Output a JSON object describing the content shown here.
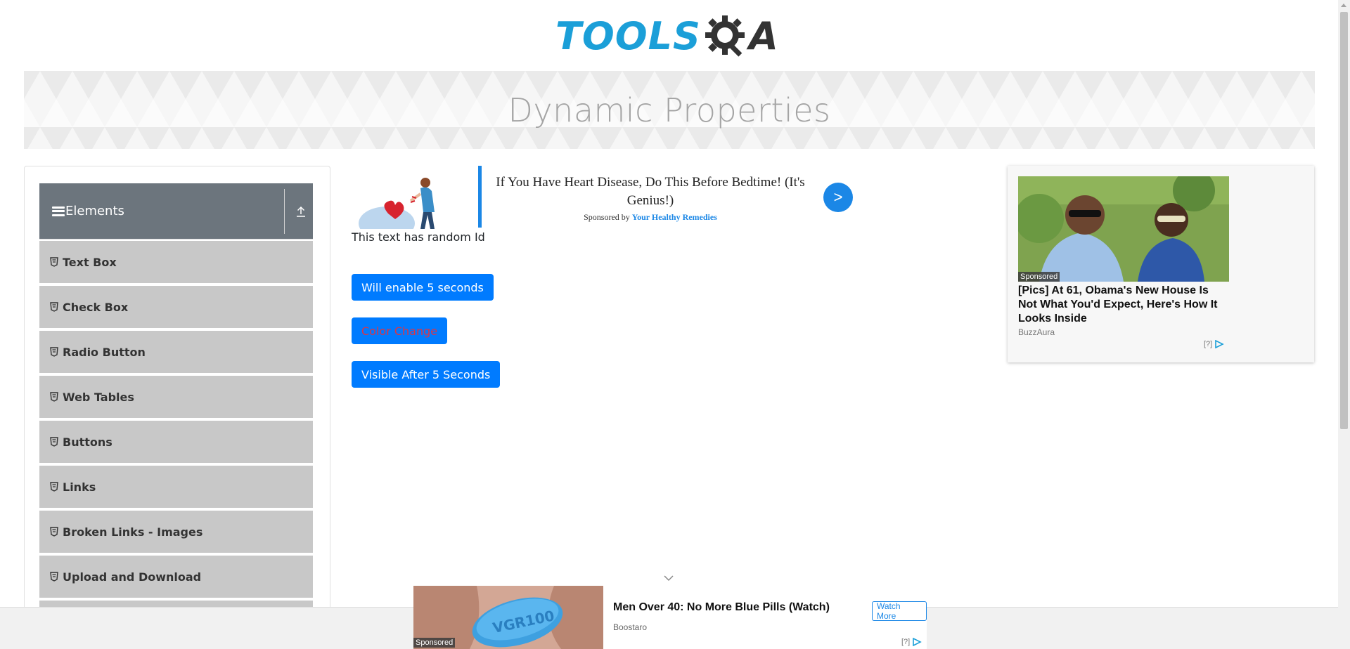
{
  "header": {
    "logo_left": "TOOLS",
    "logo_right": "A"
  },
  "banner": {
    "title": "Dynamic Properties"
  },
  "sidebar": {
    "group_title": "Elements",
    "items": [
      {
        "label": "Text Box"
      },
      {
        "label": "Check Box"
      },
      {
        "label": "Radio Button"
      },
      {
        "label": "Web Tables"
      },
      {
        "label": "Buttons"
      },
      {
        "label": "Links"
      },
      {
        "label": "Broken Links - Images"
      },
      {
        "label": "Upload and Download"
      }
    ]
  },
  "main_ad": {
    "headline": "If You Have Heart Disease, Do This Before Bedtime! (It's Genius!)",
    "sponsor_prefix": "Sponsored by",
    "sponsor_name": "Your Healthy Remedies",
    "arrow": ">"
  },
  "main": {
    "random_text": "This text has random Id",
    "enable_button": "Will enable 5 seconds",
    "color_button": "Color Change",
    "visible_button": "Visible After 5 Seconds"
  },
  "right_ad": {
    "sponsored": "Sponsored",
    "headline": "[Pics] At 61, Obama's New House Is Not What You'd Expect, Here's How It Looks Inside",
    "source": "BuzzAura",
    "adchoice": "[?]"
  },
  "bottom_ad": {
    "sponsored": "Sponsored",
    "headline": "Men Over 40: No More Blue Pills (Watch)",
    "source": "Boostaro",
    "cta": "Watch More",
    "adchoice": "[?]",
    "pill_text": "VGR100"
  },
  "colors": {
    "primary": "#007bff",
    "brand_blue": "#1b9fd8",
    "sidebar_header": "#6c757d",
    "sidebar_item": "#c8c8c8",
    "color_change_text": "#dc3545"
  }
}
